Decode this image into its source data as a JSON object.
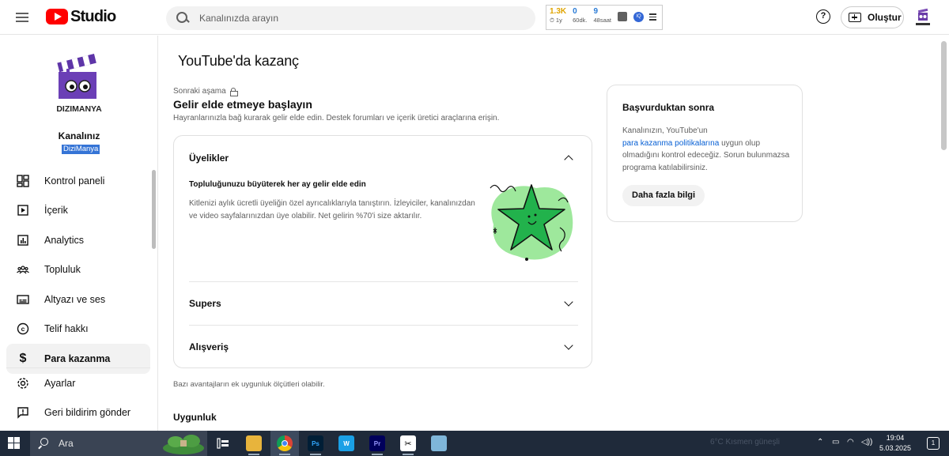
{
  "header": {
    "logo_text": "Studio",
    "search_placeholder": "Kanalınızda arayın",
    "stats": [
      {
        "value": "1.3K",
        "label": "⏱ 1y"
      },
      {
        "value": "0",
        "label": "60dk."
      },
      {
        "value": "9",
        "label": "48saat"
      }
    ],
    "help_label": "?",
    "create_label": "Oluştur"
  },
  "sidebar": {
    "channel_title": "Kanalınız",
    "channel_name": "DiziManya",
    "logo_text": "DIZIMANYA",
    "items": [
      {
        "label": "Kontrol paneli",
        "icon": "dashboard-icon"
      },
      {
        "label": "İçerik",
        "icon": "content-icon"
      },
      {
        "label": "Analytics",
        "icon": "analytics-icon"
      },
      {
        "label": "Topluluk",
        "icon": "community-icon"
      },
      {
        "label": "Altyazı ve ses",
        "icon": "subtitles-icon"
      },
      {
        "label": "Telif hakkı",
        "icon": "copyright-icon"
      },
      {
        "label": "Para kazanma",
        "icon": "dollar-icon"
      }
    ],
    "bottom_items": [
      {
        "label": "Ayarlar",
        "icon": "gear-icon"
      },
      {
        "label": "Geri bildirim gönder",
        "icon": "feedback-icon"
      }
    ]
  },
  "main": {
    "title": "YouTube'da kazanç",
    "stage_label": "Sonraki aşama",
    "stage_title": "Gelir elde etmeye başlayın",
    "stage_desc": "Hayranlarınızla bağ kurarak gelir elde edin. Destek forumları ve içerik üretici araçlarına erişin.",
    "accordion": [
      {
        "title": "Üyelikler",
        "expanded": true,
        "subtitle": "Topluluğunuzu büyüterek her ay gelir elde edin",
        "body": "Kitlenizi aylık ücretli üyeliğin özel ayrıcalıklarıyla tanıştırın. İzleyiciler, kanalınızdan ve video sayfalarınızdan üye olabilir. Net gelirin %70'i size aktarılır."
      },
      {
        "title": "Supers",
        "expanded": false
      },
      {
        "title": "Alışveriş",
        "expanded": false
      }
    ],
    "note": "Bazı avantajların ek uygunluk ölçütleri olabilir.",
    "section_title": "Uygunluk",
    "aside": {
      "title": "Başvurduktan sonra",
      "body_before": "Kanalınızın, YouTube'un",
      "link": "para kazanma politikalarına",
      "body_after": "uygun olup olmadığını kontrol edeceğiz. Sorun bulunmazsa programa katılabilirsiniz.",
      "button": "Daha fazla bilgi"
    }
  },
  "taskbar": {
    "search_label": "Ara",
    "weather": "6°C  Kısmen güneşli",
    "time": "19:04",
    "date": "5.03.2025",
    "notification_count": "1"
  },
  "colors": {
    "brand_red": "#ff0000",
    "link_blue": "#065fd4",
    "accent_green": "#22b24c"
  }
}
